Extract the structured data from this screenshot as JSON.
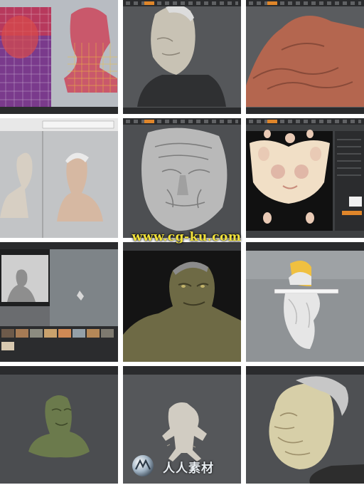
{
  "watermark": {
    "text": "www.cg-ku.com"
  },
  "logo": {
    "text": "人人素材",
    "icon": "sphere-logo-icon"
  },
  "colors": {
    "viewport_gray": "#4a4c4e",
    "ui_bar": "#2a2b2d",
    "accent_orange": "#e0862a",
    "clay": "#c9c6bf",
    "skin_red": "#b86a55",
    "watermark_yellow": "#f2e23a"
  },
  "tiles": [
    {
      "id": "uv-checker-bust"
    },
    {
      "id": "old-man-bust-profile"
    },
    {
      "id": "skin-detail-closeup"
    },
    {
      "id": "dual-viewport-busts"
    },
    {
      "id": "wrinkled-face-closeup"
    },
    {
      "id": "uv-texture-map"
    },
    {
      "id": "render-setup-thumbnails"
    },
    {
      "id": "goblin-render"
    },
    {
      "id": "base-mesh-hair"
    },
    {
      "id": "green-bust"
    },
    {
      "id": "creature-figure"
    },
    {
      "id": "final-old-man-sculpt"
    }
  ]
}
